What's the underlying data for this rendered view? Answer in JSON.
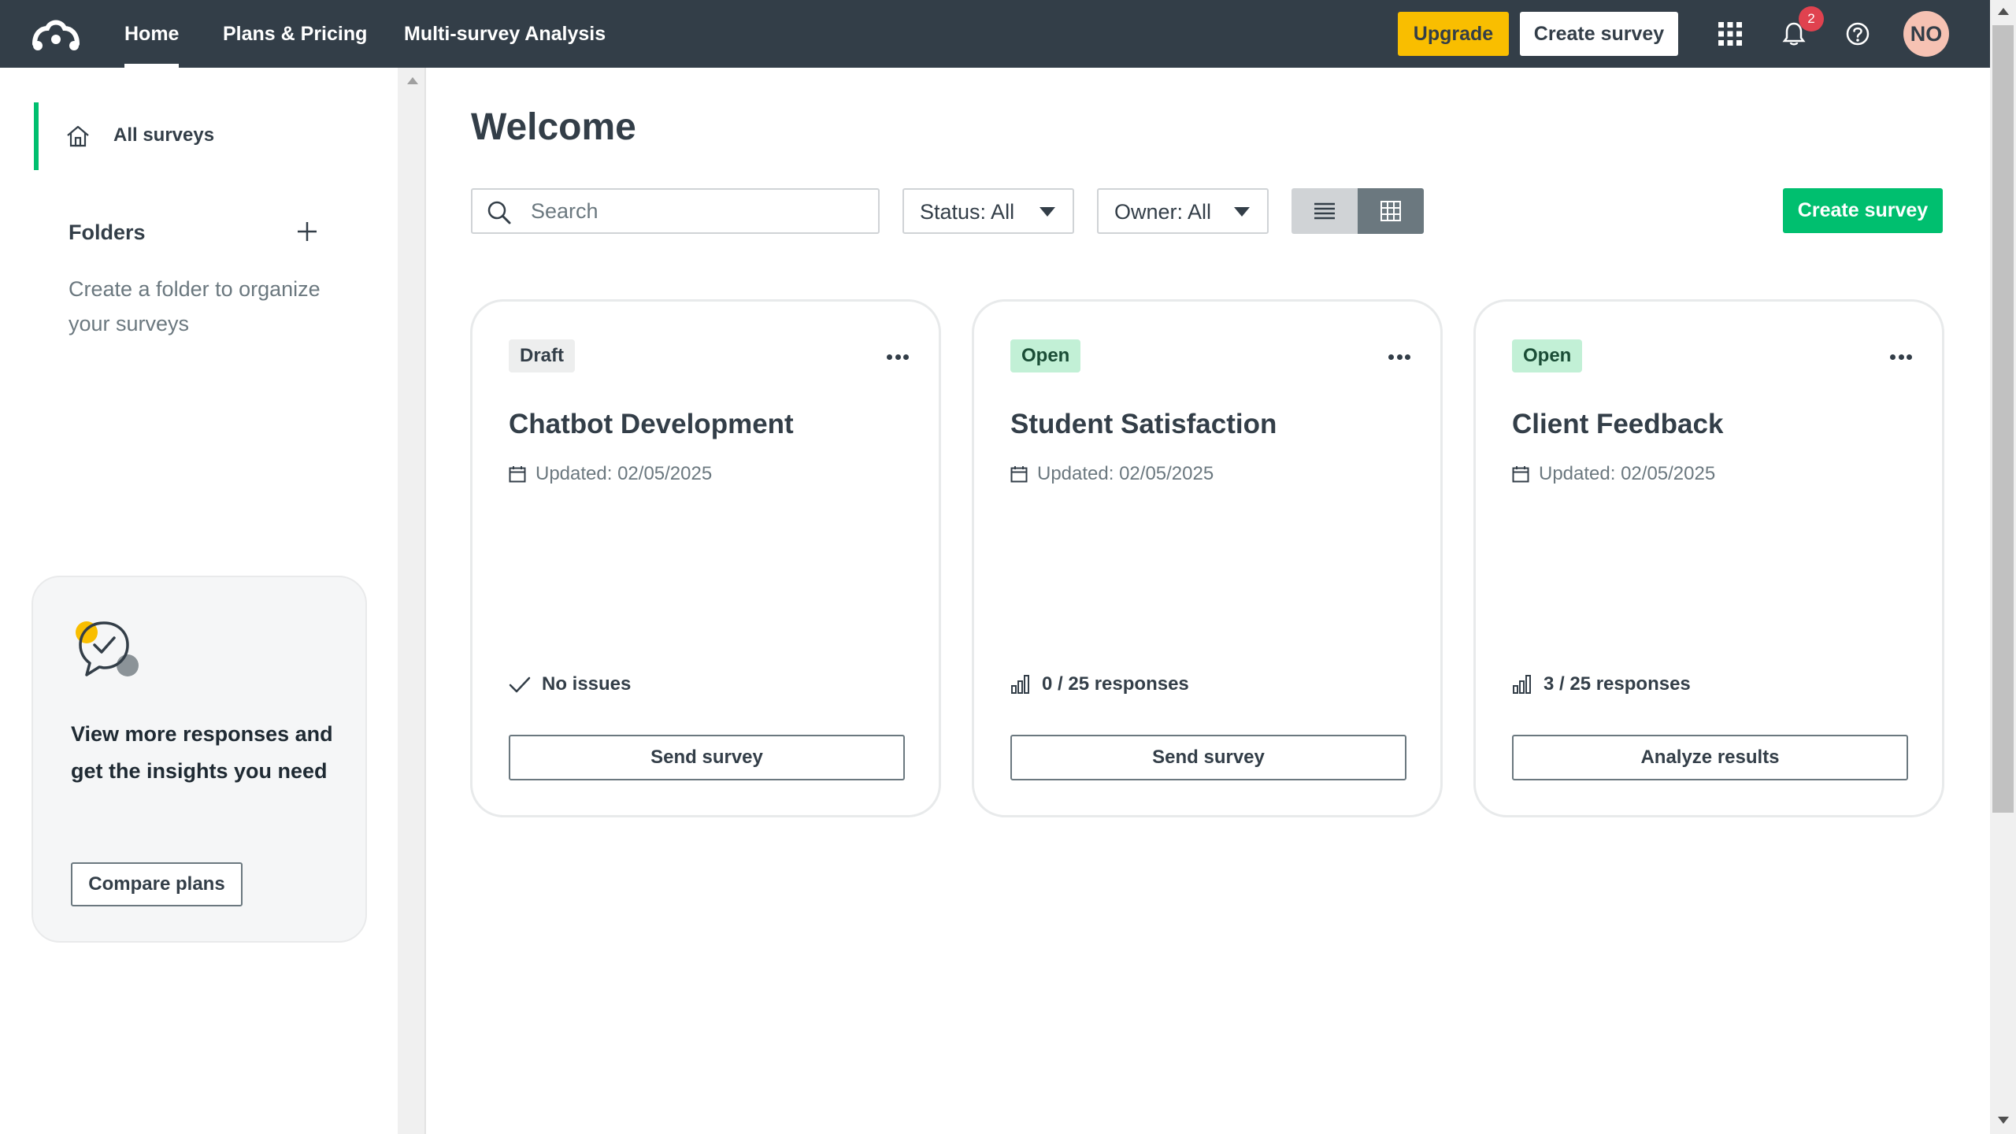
{
  "nav": {
    "home": "Home",
    "plans": "Plans & Pricing",
    "multi": "Multi-survey Analysis",
    "upgrade": "Upgrade",
    "create_survey": "Create survey",
    "notifications_count": "2",
    "avatar_initials": "NO"
  },
  "sidebar": {
    "all_surveys": "All surveys",
    "folders_title": "Folders",
    "folders_hint": "Create a folder to organize your surveys",
    "promo_text": "View more responses and get the insights you need",
    "compare_plans": "Compare plans"
  },
  "main": {
    "title": "Welcome",
    "search_placeholder": "Search",
    "status_filter": "Status: All",
    "owner_filter": "Owner: All",
    "create_survey": "Create survey"
  },
  "cards": [
    {
      "status": "Draft",
      "title": "Chatbot Development",
      "updated": "Updated: 02/05/2025",
      "stat": "No issues",
      "button": "Send survey"
    },
    {
      "status": "Open",
      "title": "Student Satisfaction",
      "updated": "Updated: 02/05/2025",
      "stat": "0 / 25 responses",
      "button": "Send survey"
    },
    {
      "status": "Open",
      "title": "Client Feedback",
      "updated": "Updated: 02/05/2025",
      "stat": "3 / 25 responses",
      "button": "Analyze results"
    }
  ],
  "colors": {
    "nav_bg": "#333e48",
    "brand_green": "#00bf6f",
    "upgrade_yellow": "#f9be00",
    "badge_red": "#e0424f",
    "open_pill": "#c2f0d6"
  },
  "icons": [
    "logo-icon",
    "apps-grid-icon",
    "bell-icon",
    "help-icon",
    "home-icon",
    "plus-icon",
    "chat-check-icon",
    "search-icon",
    "caret-down-icon",
    "list-view-icon",
    "grid-view-icon",
    "more-icon",
    "calendar-icon",
    "check-icon",
    "bar-chart-icon"
  ]
}
